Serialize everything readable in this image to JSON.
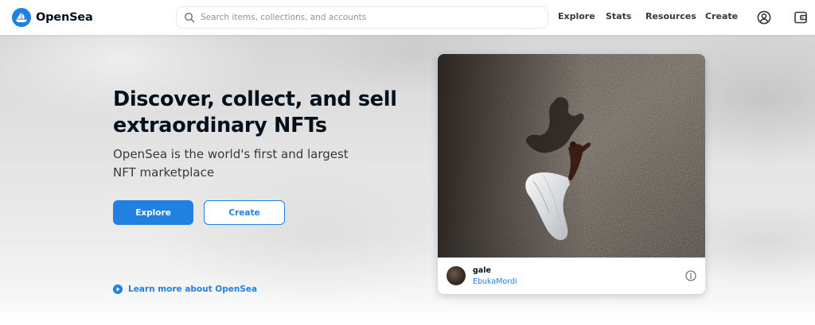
{
  "brand": {
    "name": "OpenSea",
    "accent": "#2081e2"
  },
  "search": {
    "placeholder": "Search items, collections, and accounts",
    "value": ""
  },
  "nav": {
    "links": [
      "Explore",
      "Stats",
      "Resources",
      "Create"
    ],
    "icons": [
      "account-icon",
      "wallet-icon"
    ]
  },
  "hero": {
    "headline": "Discover, collect, and sell extraordinary NFTs",
    "subheadline": "OpenSea is the world's first and largest NFT marketplace",
    "explore_label": "Explore",
    "create_label": "Create",
    "learn_more_label": "Learn more about OpenSea"
  },
  "featured": {
    "name": "gale",
    "creator": "EbukaMordi",
    "info_icon": "info-icon"
  }
}
